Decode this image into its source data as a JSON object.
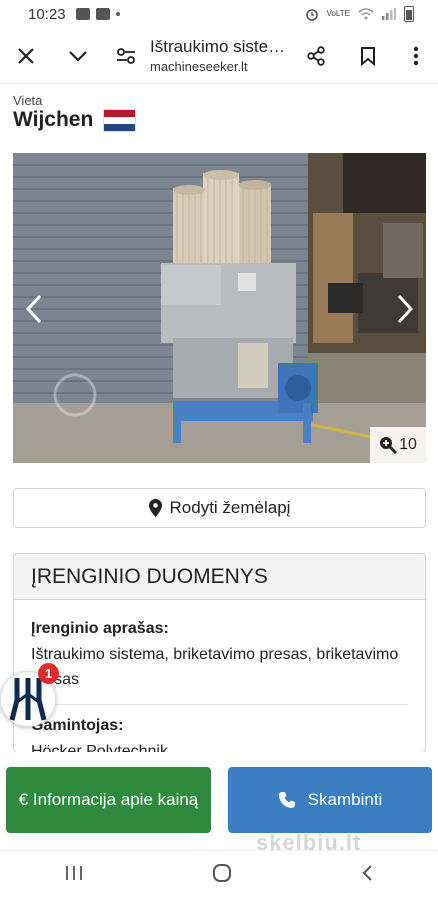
{
  "status_bar": {
    "time": "10:23",
    "network_label": "VoLTE"
  },
  "browser": {
    "title": "Ištraukimo siste…",
    "url": "machineseeker.lt",
    "icons": [
      "close-icon",
      "chevron-down-icon",
      "page-settings-icon",
      "share-icon",
      "bookmark-icon",
      "more-vert-icon"
    ]
  },
  "location": {
    "label": "Vieta",
    "city": "Wijchen",
    "flag_colors": [
      "#ae1c28",
      "#ffffff",
      "#21468b"
    ]
  },
  "gallery": {
    "photo_count": "10"
  },
  "map_button": {
    "label": "Rodyti žemėlapį"
  },
  "details": {
    "header": "ĮRENGINIO DUOMENYS",
    "fields": [
      {
        "label": "Įrenginio aprašas:",
        "value": "Ištraukimo sistema, briketavimo presas, briketavimo presas"
      },
      {
        "label": "Gamintojas:",
        "value": "Höcker Polytechnik"
      }
    ]
  },
  "float_widget": {
    "badge": "1"
  },
  "actions": {
    "price_label": "€ Informacija apie kainą",
    "call_label": "Skambinti",
    "price_color": "#2e8b3e",
    "call_color": "#3b7ec1"
  },
  "watermark": "skelbiu.lt"
}
